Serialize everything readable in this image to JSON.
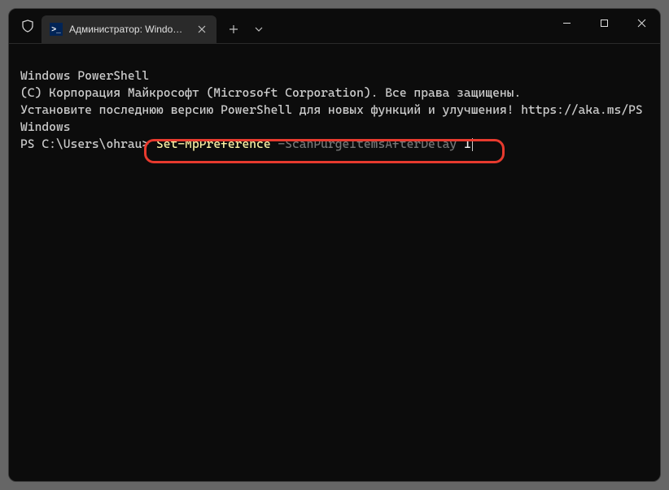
{
  "tab": {
    "title": "Администратор: Windows Po"
  },
  "terminal": {
    "line1": "Windows PowerShell",
    "line2": "(C) Корпорация Майкрософт (Microsoft Corporation). Все права защищены.",
    "blank1": "",
    "line3": "Установите последнюю версию PowerShell для новых функций и улучшения! https://aka.ms/PSWindows",
    "blank2": "",
    "prompt": "PS C:\\Users\\ohrau> ",
    "cmd_yellow": "Set-MpPreference",
    "cmd_gray": " -ScanPurgeItemsAfterDelay ",
    "cmd_arg": "1"
  }
}
